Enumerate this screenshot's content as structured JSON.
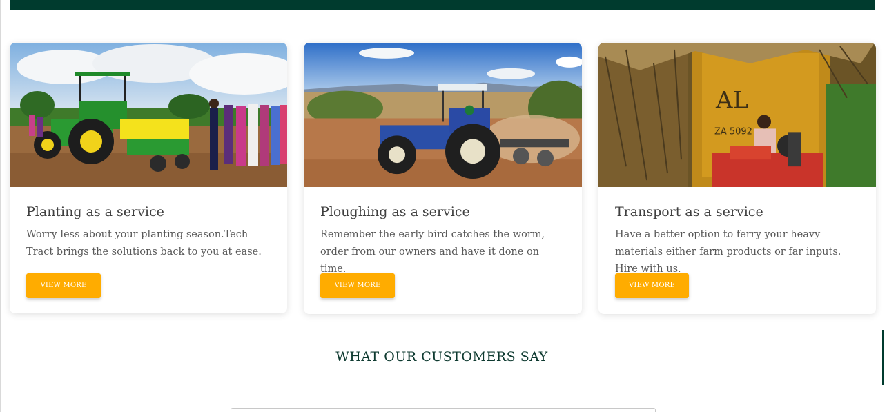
{
  "services": [
    {
      "title": "Planting as a service",
      "text": "Worry less about your planting season.Tech Tract brings the solutions back to you at ease.",
      "button": "VIEW MORE",
      "image_icon": "planting-tractor-photo"
    },
    {
      "title": "Ploughing as a service",
      "text": "Remember the early bird catches the worm, order from our owners and have it done on time.",
      "button": "VIEW MORE",
      "image_icon": "ploughing-tractor-photo"
    },
    {
      "title": "Transport as a service",
      "text": "Have a better option to ferry your heavy materials either farm products or far inputs. Hire with us.",
      "button": "VIEW MORE",
      "image_icon": "transport-tractor-photo"
    }
  ],
  "testimonials": {
    "heading": "WHAT OUR CUSTOMERS SAY"
  },
  "photo_text": {
    "trailer_logo": "AL",
    "trailer_plate": "ZA 5092"
  },
  "colors": {
    "brand_dark": "#003b2e",
    "accent": "#ffac00",
    "heading": "#0e3a30"
  }
}
